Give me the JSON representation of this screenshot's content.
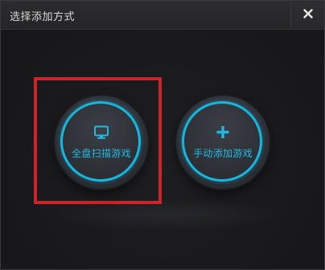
{
  "dialog": {
    "title": "选择添加方式",
    "close_icon": "close-icon"
  },
  "options": [
    {
      "label": "全盘扫描游戏",
      "icon": "monitor-icon"
    },
    {
      "label": "手动添加游戏",
      "icon": "plus-icon"
    }
  ],
  "colors": {
    "accent": "#17b6e0",
    "highlight": "#c9252a",
    "background": "#1b1b1d"
  }
}
